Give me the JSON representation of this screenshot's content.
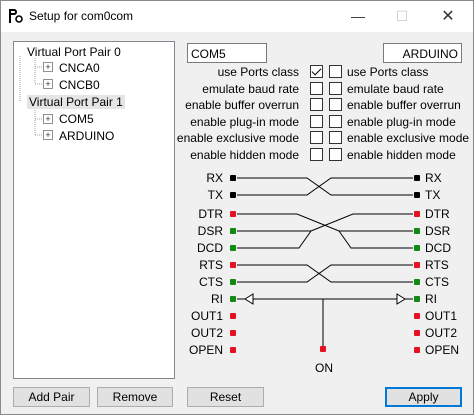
{
  "window": {
    "title": "Setup for com0com",
    "controls": {
      "minimize": "—",
      "maximize": "☐",
      "close": "✕"
    }
  },
  "tree": {
    "items": [
      {
        "label": "Virtual Port Pair 0",
        "expander": "–"
      },
      {
        "label": "CNCA0",
        "expander": "+"
      },
      {
        "label": "CNCB0",
        "expander": "+"
      },
      {
        "label": "Virtual Port Pair 1",
        "expander": "–"
      },
      {
        "label": "COM5",
        "expander": "+"
      },
      {
        "label": "ARDUINO",
        "expander": "+"
      }
    ]
  },
  "ports": {
    "left_name": "COM5",
    "right_name": "ARDUINO"
  },
  "options": [
    {
      "label": "use Ports class",
      "left_checked": true,
      "right_checked": false
    },
    {
      "label": "emulate baud rate",
      "left_checked": false,
      "right_checked": false
    },
    {
      "label": "enable buffer overrun",
      "left_checked": false,
      "right_checked": false
    },
    {
      "label": "enable plug-in mode",
      "left_checked": false,
      "right_checked": false
    },
    {
      "label": "enable exclusive mode",
      "left_checked": false,
      "right_checked": false
    },
    {
      "label": "enable hidden mode",
      "left_checked": false,
      "right_checked": false
    }
  ],
  "signals": {
    "left": [
      {
        "label": "RX",
        "color": "#000000"
      },
      {
        "label": "TX",
        "color": "#000000"
      },
      {
        "label": "DTR",
        "color": "#e81123"
      },
      {
        "label": "DSR",
        "color": "#108a10"
      },
      {
        "label": "DCD",
        "color": "#108a10"
      },
      {
        "label": "RTS",
        "color": "#e81123"
      },
      {
        "label": "CTS",
        "color": "#108a10"
      },
      {
        "label": "RI",
        "color": "#108a10"
      },
      {
        "label": "OUT1",
        "color": "#e81123"
      },
      {
        "label": "OUT2",
        "color": "#e81123"
      },
      {
        "label": "OPEN",
        "color": "#e81123"
      }
    ],
    "right": [
      {
        "label": "RX",
        "color": "#000000"
      },
      {
        "label": "TX",
        "color": "#000000"
      },
      {
        "label": "DTR",
        "color": "#e81123"
      },
      {
        "label": "DSR",
        "color": "#108a10"
      },
      {
        "label": "DCD",
        "color": "#108a10"
      },
      {
        "label": "RTS",
        "color": "#e81123"
      },
      {
        "label": "CTS",
        "color": "#108a10"
      },
      {
        "label": "RI",
        "color": "#108a10"
      },
      {
        "label": "OUT1",
        "color": "#e81123"
      },
      {
        "label": "OUT2",
        "color": "#e81123"
      },
      {
        "label": "OPEN",
        "color": "#e81123"
      }
    ],
    "on_label": "ON",
    "on_color": "#e81123"
  },
  "buttons": {
    "add_pair": "Add Pair",
    "remove": "Remove",
    "reset": "Reset",
    "apply": "Apply"
  }
}
